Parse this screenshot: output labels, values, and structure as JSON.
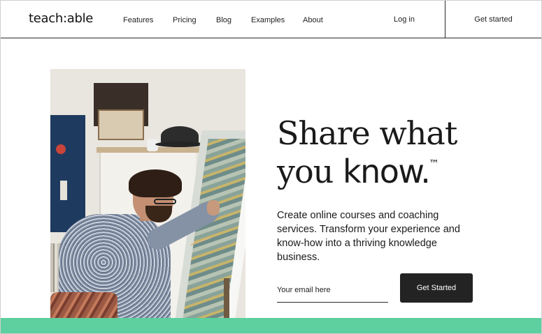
{
  "header": {
    "logo": "teach:able",
    "nav": [
      "Features",
      "Pricing",
      "Blog",
      "Examples",
      "About"
    ],
    "login": "Log in",
    "get_started": "Get started"
  },
  "hero": {
    "headline_line1": "Share what",
    "headline_line2_regular": "you ",
    "headline_line2_bold": "know.",
    "trademark": "™",
    "description": "Create online courses and coaching services. Transform your experience and know-how into a thriving knowledge business.",
    "email_placeholder": "Your email here",
    "email_value": "",
    "cta": "Get Started"
  },
  "colors": {
    "accent_green": "#5ecf9e",
    "button_dark": "#232323"
  }
}
